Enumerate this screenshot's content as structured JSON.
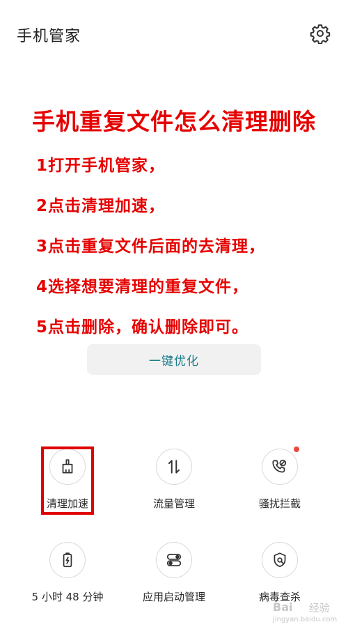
{
  "header": {
    "title": "手机管家",
    "settings_icon": "gear-icon"
  },
  "overlay": {
    "title": "手机重复文件怎么清理删除",
    "color": "#e60000",
    "steps": [
      "1打开手机管家，",
      "2点击清理加速，",
      "3点击重复文件后面的去清理，",
      "4选择想要清理的重复文件，",
      "5点击删除，确认删除即可。"
    ]
  },
  "main": {
    "optimize_label": "一键优化",
    "accent": "#1b7c8a"
  },
  "tools": [
    {
      "label": "清理加速",
      "icon": "broom-icon",
      "highlighted": true
    },
    {
      "label": "流量管理",
      "icon": "data-transfer-icon"
    },
    {
      "label": "骚扰拦截",
      "icon": "phone-block-icon",
      "badge": true
    },
    {
      "label": "5 小时 48 分钟",
      "icon": "battery-icon"
    },
    {
      "label": "应用启动管理",
      "icon": "app-launch-icon"
    },
    {
      "label": "病毒查杀",
      "icon": "shield-scan-icon"
    }
  ],
  "watermark": {
    "logo": "Bai",
    "cn": "经验",
    "url": "jingyan.baidu.com"
  }
}
